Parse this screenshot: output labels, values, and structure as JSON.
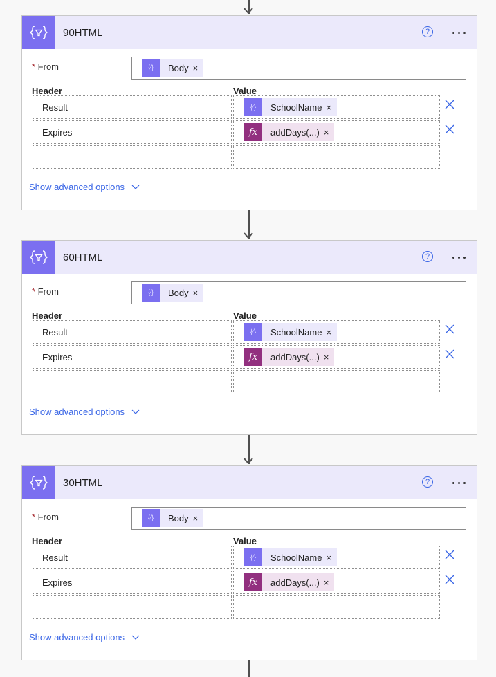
{
  "actions": [
    {
      "title": "90HTML",
      "from_label": "From",
      "from_token": {
        "icon": "dynamic-content-icon",
        "label": "Body"
      },
      "columns": {
        "header": "Header",
        "value": "Value"
      },
      "rows": [
        {
          "header": "Result",
          "value": {
            "type": "dynamic",
            "icon": "dynamic-content-icon",
            "label": "SchoolName"
          }
        },
        {
          "header": "Expires",
          "value": {
            "type": "expression",
            "icon": "fx-icon",
            "label": "addDays(...)"
          }
        },
        {
          "header": "",
          "value": null
        }
      ],
      "advanced_label": "Show advanced options"
    },
    {
      "title": "60HTML",
      "from_label": "From",
      "from_token": {
        "icon": "dynamic-content-icon",
        "label": "Body"
      },
      "columns": {
        "header": "Header",
        "value": "Value"
      },
      "rows": [
        {
          "header": "Result",
          "value": {
            "type": "dynamic",
            "icon": "dynamic-content-icon",
            "label": "SchoolName"
          }
        },
        {
          "header": "Expires",
          "value": {
            "type": "expression",
            "icon": "fx-icon",
            "label": "addDays(...)"
          }
        },
        {
          "header": "",
          "value": null
        }
      ],
      "advanced_label": "Show advanced options"
    },
    {
      "title": "30HTML",
      "from_label": "From",
      "from_token": {
        "icon": "dynamic-content-icon",
        "label": "Body"
      },
      "columns": {
        "header": "Header",
        "value": "Value"
      },
      "rows": [
        {
          "header": "Result",
          "value": {
            "type": "dynamic",
            "icon": "dynamic-content-icon",
            "label": "SchoolName"
          }
        },
        {
          "header": "Expires",
          "value": {
            "type": "expression",
            "icon": "fx-icon",
            "label": "addDays(...)"
          }
        },
        {
          "header": "",
          "value": null
        }
      ],
      "advanced_label": "Show advanced options"
    }
  ],
  "icons": {
    "action_icon": "compose-filter-icon",
    "help": "?",
    "token_close": "×",
    "fx": "fx",
    "dynamic": "{⁄}"
  },
  "colors": {
    "accent": "#7b6ff0",
    "header_bg": "#ebe9fb",
    "expression": "#92307f",
    "expression_bg": "#f0e1ef",
    "link": "#3a66e6"
  }
}
